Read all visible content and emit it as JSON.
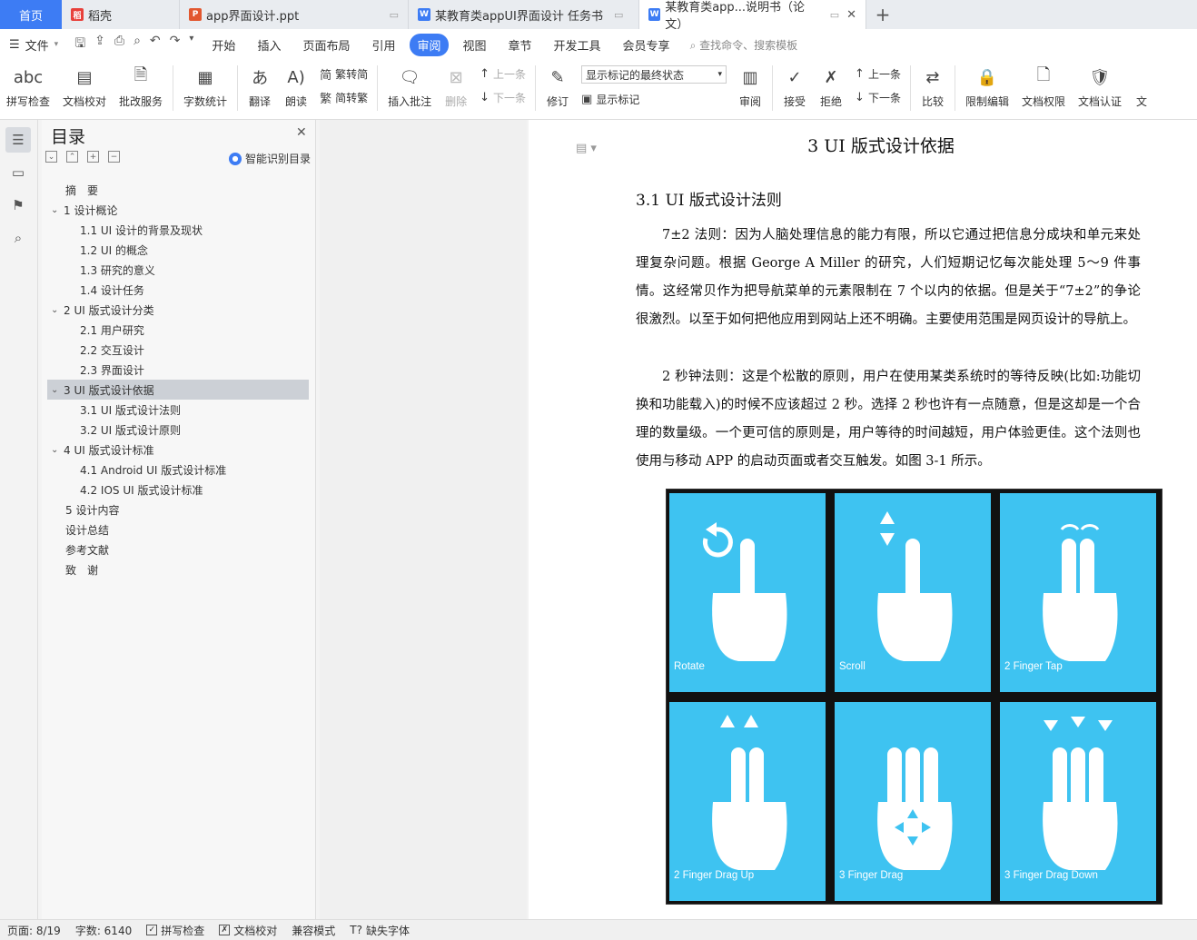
{
  "tabs": {
    "home": "首页",
    "items": [
      {
        "label": "稻壳",
        "icon": "daoke-icon",
        "color": "#e8403a"
      },
      {
        "label": "app界面设计.ppt",
        "icon": "ppt-icon",
        "color": "#e2572f"
      },
      {
        "label": "某教育类appUI界面设计 任务书",
        "icon": "word-icon",
        "color": "#3d7cf4"
      },
      {
        "label": "某教育类app...说明书（论文）",
        "icon": "word-icon",
        "color": "#3d7cf4"
      }
    ]
  },
  "menubar": {
    "file": "文件",
    "items": [
      "开始",
      "插入",
      "页面布局",
      "引用",
      "审阅",
      "视图",
      "章节",
      "开发工具",
      "会员专享"
    ],
    "active": "审阅",
    "search": "查找命令、搜索模板"
  },
  "ribbon": {
    "spell": "拼写检查",
    "proof": "文档校对",
    "batch": "批改服务",
    "wordcount": "字数统计",
    "translate": "翻译",
    "read": "朗读",
    "trad": "繁转简",
    "simp": "简转繁",
    "insert_comment": "插入批注",
    "delete": "删除",
    "prev": "上一条",
    "next": "下一条",
    "revise": "修订",
    "markup_select": "显示标记的最终状态",
    "show_markup": "显示标记",
    "review": "审阅",
    "accept": "接受",
    "reject": "拒绝",
    "prev2": "上一条",
    "next2": "下一条",
    "compare": "比较",
    "restrict": "限制编辑",
    "doc_perm": "文档权限",
    "doc_cert": "文档认证",
    "more": "文"
  },
  "toc": {
    "title": "目录",
    "smart": "智能识别目录",
    "items": [
      {
        "label": "摘　要",
        "level": 0
      },
      {
        "label": "1  设计概论",
        "level": 1
      },
      {
        "label": "1.1 UI 设计的背景及现状",
        "level": 2
      },
      {
        "label": "1.2 UI 的概念",
        "level": 2
      },
      {
        "label": "1.3 研究的意义",
        "level": 2
      },
      {
        "label": "1.4 设计任务",
        "level": 2
      },
      {
        "label": "2 UI 版式设计分类",
        "level": 1
      },
      {
        "label": "2.1 用户研究",
        "level": 2
      },
      {
        "label": "2.2  交互设计",
        "level": 2
      },
      {
        "label": "2.3  界面设计",
        "level": 2
      },
      {
        "label": "3 UI 版式设计依据",
        "level": 1,
        "selected": true
      },
      {
        "label": "3.1 UI 版式设计法则",
        "level": 2
      },
      {
        "label": "3.2 UI 版式设计原则",
        "level": 2
      },
      {
        "label": "4 UI 版式设计标准",
        "level": 1
      },
      {
        "label": "4.1 Android UI 版式设计标准",
        "level": 2
      },
      {
        "label": "4.2 IOS UI 版式设计标准",
        "level": 2
      },
      {
        "label": "5  设计内容",
        "level": 0
      },
      {
        "label": "设计总结",
        "level": 0
      },
      {
        "label": "参考文献",
        "level": 0
      },
      {
        "label": "致　谢",
        "level": 0
      }
    ]
  },
  "document": {
    "chapter": "3 UI 版式设计依据",
    "section": "3.1 UI 版式设计法则",
    "para1": "7±2 法则：因为人脑处理信息的能力有限，所以它通过把信息分成块和单元来处理复杂问题。根据 George A Miller 的研究，人们短期记忆每次能处理 5～9 件事情。这经常贝作为把导航菜单的元素限制在 7 个以内的依据。但是关于“7±2”的争论很激烈。以至于如何把他应用到网站上还不明确。主要使用范围是网页设计的导航上。",
    "para2": "2 秒钟法则：这是个松散的原则，用户在使用某类系统时的等待反映(比如:功能切换和功能载入)的时候不应该超过 2 秒。选择 2 秒也许有一点随意，但是这却是一个合理的数量级。一个更可信的原则是，用户等待的时间越短，用户体验更佳。这个法则也使用与移动 APP 的启动页面或者交互触发。如图 3-1 所示。",
    "figure": {
      "bg_color": "#3ec3f1",
      "gestures": [
        "Rotate",
        "Scroll",
        "2 Finger Tap",
        "2 Finger Drag Up",
        "3 Finger Drag",
        "3 Finger Drag Down"
      ]
    }
  },
  "status": {
    "page": "页面: 8/19",
    "words": "字数: 6140",
    "spell": "拼写检查",
    "proof": "文档校对",
    "compat": "兼容模式",
    "missing_font": "缺失字体"
  }
}
